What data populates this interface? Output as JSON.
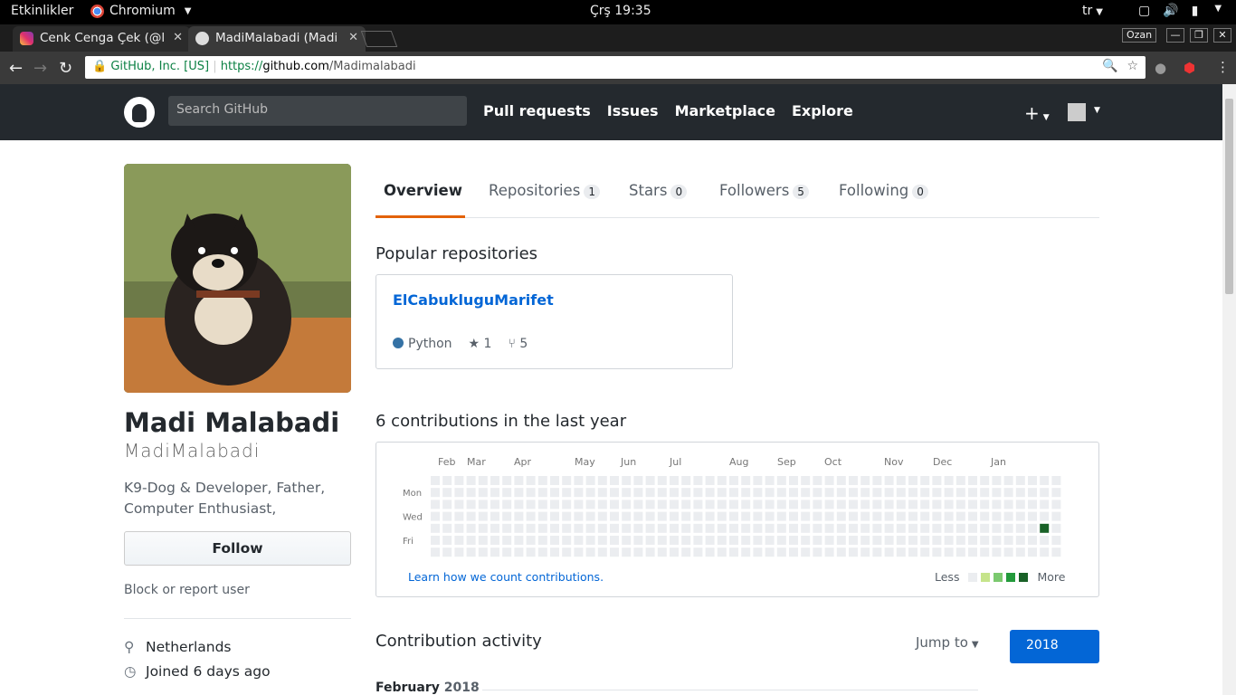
{
  "desktop": {
    "activities": "Etkinlikler",
    "app_name": "Chromium",
    "clock": "Çrş 19:35",
    "lang": "tr"
  },
  "browser": {
    "tabs": [
      {
        "title": "Cenk Cenga Çek (@l",
        "active": false
      },
      {
        "title": "MadiMalabadi (Madi",
        "active": true
      }
    ],
    "profile": "Ozan",
    "omnibox": {
      "ev_label": "GitHub, Inc. [US]",
      "protocol": "https://",
      "host": "github.com",
      "path": "/Madimalabadi"
    }
  },
  "github": {
    "search_placeholder": "Search GitHub",
    "nav": [
      "Pull requests",
      "Issues",
      "Marketplace",
      "Explore"
    ],
    "plus_icon": "+"
  },
  "profile": {
    "name": "Madi Malabadi",
    "login": "MadiMalabadi",
    "bio": "K9-Dog & Developer, Father, Computer Enthusiast,",
    "follow_label": "Follow",
    "block_label": "Block or report user",
    "location": "Netherlands",
    "joined": "Joined 6 days ago"
  },
  "tabs": [
    {
      "label": "Overview",
      "count": null
    },
    {
      "label": "Repositories",
      "count": "1"
    },
    {
      "label": "Stars",
      "count": "0"
    },
    {
      "label": "Followers",
      "count": "5"
    },
    {
      "label": "Following",
      "count": "0"
    }
  ],
  "popular": {
    "heading": "Popular repositories",
    "repo": {
      "name": "ElCabukluguMarifet",
      "language": "Python",
      "language_color": "#3572A5",
      "stars": "1",
      "forks": "5"
    }
  },
  "contributions": {
    "heading": "6 contributions in the last year",
    "months": [
      "Feb",
      "Mar",
      "Apr",
      "May",
      "Jun",
      "Jul",
      "Aug",
      "Sep",
      "Oct",
      "Nov",
      "Dec",
      "Jan"
    ],
    "days": [
      "Mon",
      "Wed",
      "Fri"
    ],
    "weeks": 53,
    "active_cell": {
      "week": 51,
      "day": 4,
      "level": 4
    },
    "learn_link": "Learn how we count contributions.",
    "less": "Less",
    "more": "More",
    "colors": [
      "#ebedf0",
      "#c6e48b",
      "#7bc96f",
      "#239a3b",
      "#196127"
    ]
  },
  "activity": {
    "heading": "Contribution activity",
    "jump_to": "Jump to",
    "year": "2018",
    "month_label": "February",
    "month_year": "2018"
  }
}
